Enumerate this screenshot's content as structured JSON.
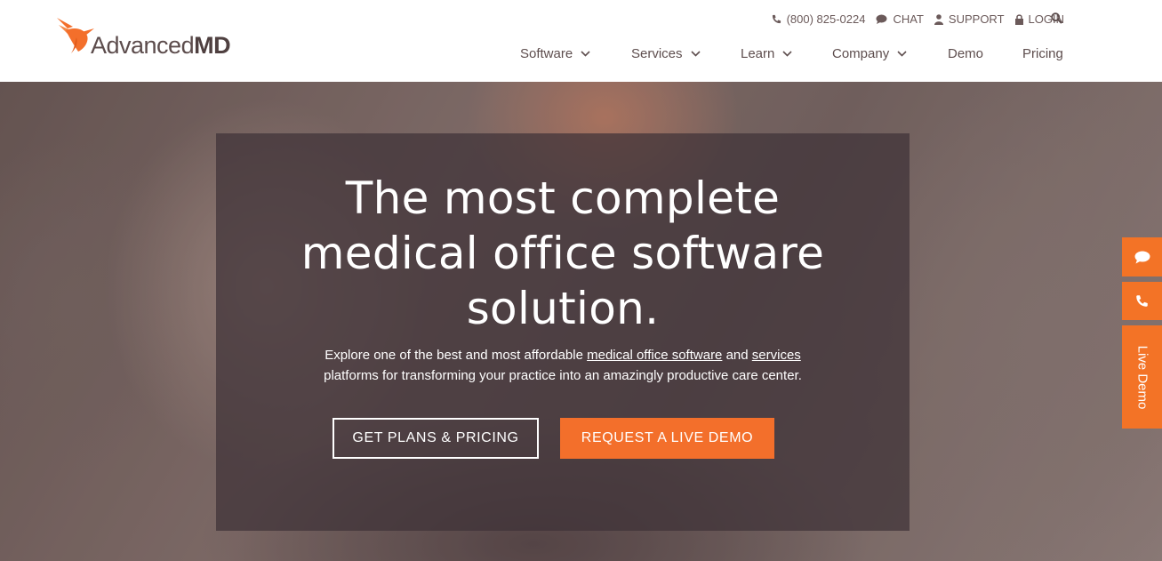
{
  "header": {
    "logo_text_light": "Advanced",
    "logo_text_bold": "MD",
    "utility": {
      "phone": "(800) 825-0224",
      "chat": "CHAT",
      "support": "SUPPORT",
      "login": "LOGIN"
    },
    "nav": [
      {
        "label": "Software",
        "has_dropdown": true
      },
      {
        "label": "Services",
        "has_dropdown": true
      },
      {
        "label": "Learn",
        "has_dropdown": true
      },
      {
        "label": "Company",
        "has_dropdown": true
      },
      {
        "label": "Demo",
        "has_dropdown": false
      },
      {
        "label": "Pricing",
        "has_dropdown": false
      }
    ]
  },
  "hero": {
    "headline_lines": [
      "The most complete",
      "medical office software",
      "solution."
    ],
    "sub_before": "Explore one of the best and most affordable ",
    "sub_link1": "medical office software",
    "sub_mid": " and ",
    "sub_link2": "services",
    "sub_after": "platforms for transforming your practice into an amazingly productive care center.",
    "btn_plans": "GET PLANS & PRICING",
    "btn_demo": "REQUEST A LIVE DEMO"
  },
  "side_tabs": {
    "chat_icon": "chat-bubble-icon",
    "phone_icon": "phone-icon",
    "demo_label": "Live Demo"
  },
  "colors": {
    "accent": "#f36f2b",
    "text": "#5a4a4a"
  }
}
